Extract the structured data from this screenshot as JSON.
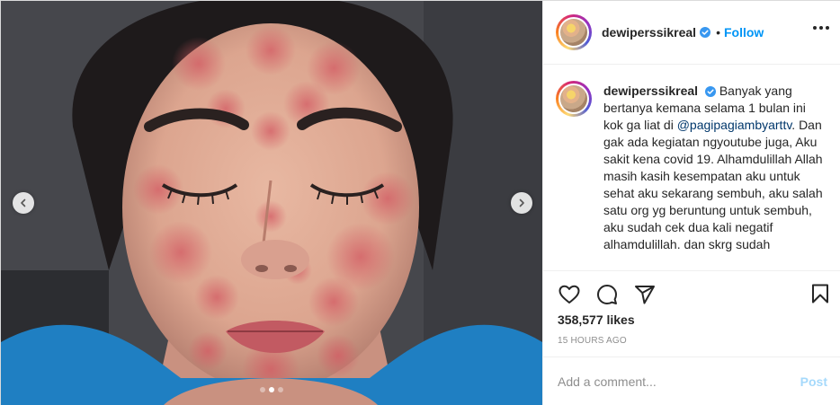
{
  "post": {
    "username": "dewiperssikreal",
    "follow_label": "Follow",
    "separator": "•",
    "caption_user": "dewiperssikreal",
    "caption_part1": "Banyak yang bertanya kemana selama 1 bulan ini kok ga liat di ",
    "caption_mention": "@pagipagiambyarttv",
    "caption_part2": ". Dan gak ada kegiatan ngyoutube juga, Aku sakit kena covid 19. Alhamdulillah Allah masih kasih kesempatan aku untuk sehat aku sekarang sembuh, aku salah satu org yg beruntung untuk sembuh, aku sudah cek dua kali negatif alhamdulillah. dan skrg sudah",
    "likes": "358,577 likes",
    "time": "15 HOURS AGO",
    "comment_placeholder": "Add a comment...",
    "post_label": "Post"
  },
  "carousel": {
    "slide_count": 3,
    "active_slide": 1
  },
  "icons": {
    "verified": "verified-badge-icon",
    "more": "more-options-icon",
    "like": "heart-icon",
    "comment": "comment-icon",
    "share": "share-icon",
    "save": "bookmark-icon",
    "prev": "chevron-left-icon",
    "next": "chevron-right-icon"
  },
  "colors": {
    "accent": "#0095f6",
    "verified": "#3897f0",
    "text": "#262626",
    "muted": "#8e8e8e",
    "mention": "#00376b"
  }
}
